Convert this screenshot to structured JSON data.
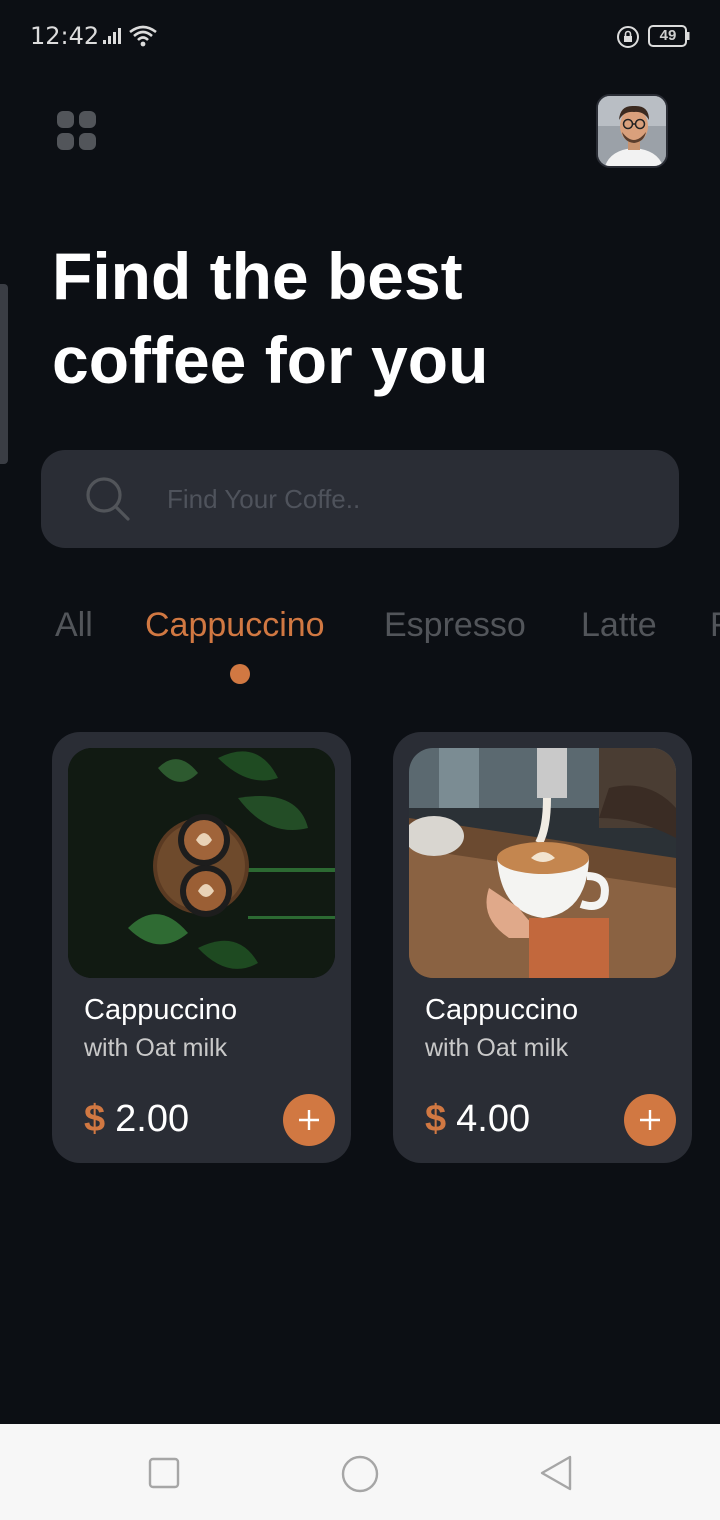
{
  "status_bar": {
    "time": "12:42",
    "battery": "49",
    "icons": [
      "signal-icon",
      "wifi-icon",
      "lock-rotate-icon",
      "battery-icon"
    ]
  },
  "header": {
    "menu_icon": "menu-grid-icon",
    "avatar": "avatar"
  },
  "title": {
    "line1": "Find the best",
    "line2": "coffee for you"
  },
  "search": {
    "placeholder": "Find Your Coffe..",
    "icon": "search-icon"
  },
  "tabs": [
    {
      "label": "All",
      "active": false
    },
    {
      "label": "Cappuccino",
      "active": true
    },
    {
      "label": "Espresso",
      "active": false
    },
    {
      "label": "Latte",
      "active": false
    },
    {
      "label": "F",
      "active": false
    }
  ],
  "products": [
    {
      "name": "Cappuccino",
      "subtitle": "with Oat milk",
      "currency": "$",
      "price": "2.00"
    },
    {
      "name": "Cappuccino",
      "subtitle": "with Oat milk",
      "currency": "$",
      "price": "4.00"
    }
  ],
  "colors": {
    "background": "#0c0f14",
    "card": "#2a2d35",
    "accent": "#d17842",
    "inactive_text": "#52555a"
  },
  "nav_bar": {
    "icons": [
      "nav-recents-icon",
      "nav-home-icon",
      "nav-back-icon"
    ]
  }
}
